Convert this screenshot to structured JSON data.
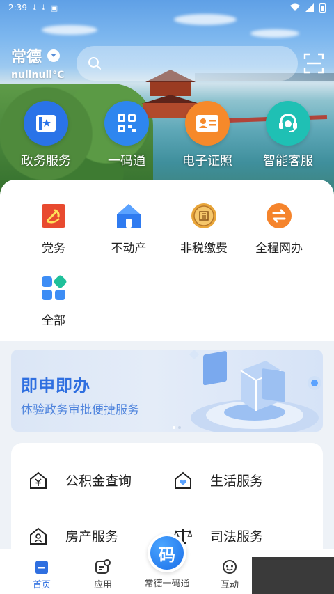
{
  "status_bar": {
    "time": "2:39",
    "icons": [
      "download-icon",
      "download-icon",
      "image-icon"
    ],
    "right_icons": [
      "wifi-icon",
      "signal-icon",
      "battery-icon"
    ]
  },
  "location": {
    "city": "常德",
    "temperature": "nullnull°C"
  },
  "search": {
    "placeholder": ""
  },
  "quick_entries": [
    {
      "label": "政务服务",
      "icon": "book-star-icon",
      "color": "#2a73e8"
    },
    {
      "label": "一码通",
      "icon": "qr-code-icon",
      "color": "#2e86ef"
    },
    {
      "label": "电子证照",
      "icon": "id-card-icon",
      "color": "#f6892a"
    },
    {
      "label": "智能客服",
      "icon": "headset-icon",
      "color": "#1fc0b4"
    }
  ],
  "grid_items": [
    {
      "label": "党务",
      "icon": "party-emblem-icon"
    },
    {
      "label": "不动产",
      "icon": "house-icon"
    },
    {
      "label": "非税缴费",
      "icon": "coin-icon"
    },
    {
      "label": "全程网办",
      "icon": "exchange-icon"
    },
    {
      "label": "全部",
      "icon": "all-apps-icon"
    }
  ],
  "banner": {
    "title": "即申即办",
    "subtitle": "体验政务审批便捷服务"
  },
  "services": [
    {
      "label": "公积金查询",
      "icon": "house-yuan-icon"
    },
    {
      "label": "生活服务",
      "icon": "house-heart-icon"
    },
    {
      "label": "房产服务",
      "icon": "house-person-icon"
    },
    {
      "label": "司法服务",
      "icon": "scales-icon"
    }
  ],
  "nav": {
    "tabs": [
      {
        "label": "首页",
        "icon": "home-icon"
      },
      {
        "label": "应用",
        "icon": "apps-icon"
      },
      {
        "label": "常德一码通",
        "icon": "code-icon",
        "fab_glyph": "码"
      },
      {
        "label": "互动",
        "icon": "chat-icon"
      }
    ]
  },
  "colors": {
    "accent": "#2f6fe0"
  }
}
